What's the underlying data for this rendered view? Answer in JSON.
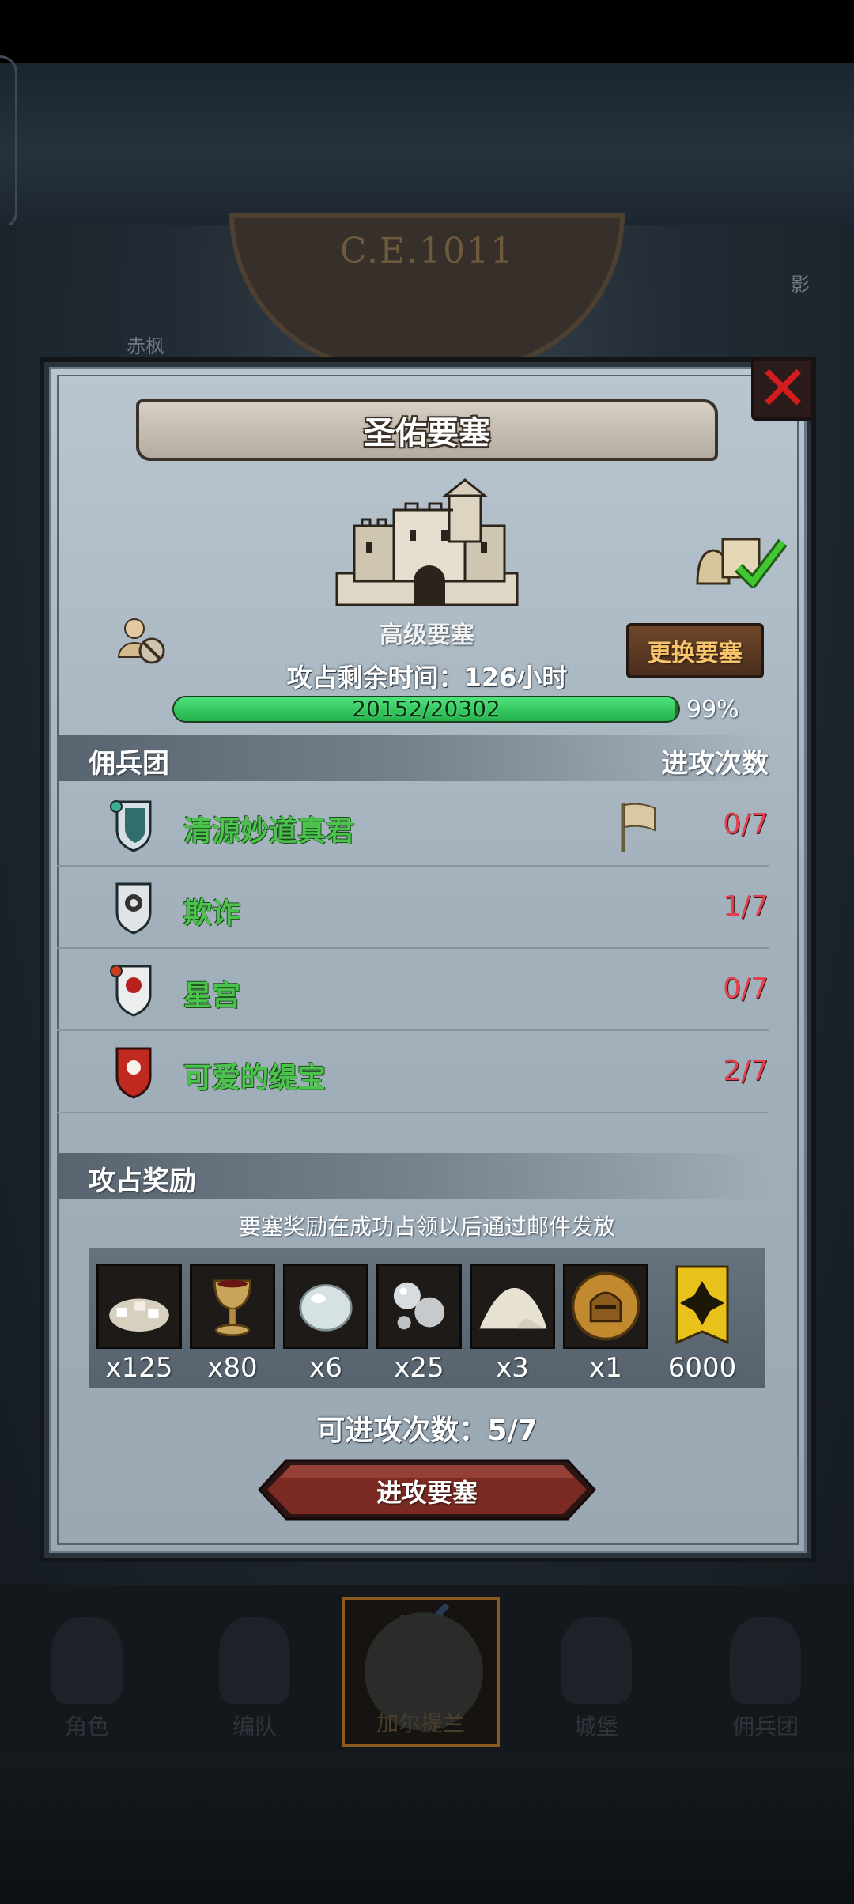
{
  "background": {
    "era": "C.E.1011",
    "map_labels": [
      "赤枫",
      "影"
    ]
  },
  "dialog": {
    "title": "圣佑要塞",
    "fortress_type": "高级要塞",
    "change_button": "更换要塞",
    "time_left": "攻占剩余时间：126小时",
    "progress": {
      "text": "20152/20302",
      "current": 20152,
      "total": 20302,
      "percent_label": "99%"
    },
    "mercenary_section": {
      "title": "佣兵团",
      "count_header": "进攻次数",
      "rows": [
        {
          "name": "清源妙道真君",
          "count": "0/7",
          "shield": "shield-green-icon",
          "flag": true
        },
        {
          "name": "欺诈",
          "count": "1/7",
          "shield": "shield-grey-icon",
          "flag": false
        },
        {
          "name": "星宫",
          "count": "0/7",
          "shield": "shield-red-white-icon",
          "flag": false
        },
        {
          "name": "可爱的缇宝",
          "count": "2/7",
          "shield": "shield-red-icon",
          "flag": false
        }
      ]
    },
    "reward_section": {
      "title": "攻占奖励",
      "note": "要塞奖励在成功占领以后通过邮件发放",
      "items": [
        {
          "icon": "stone-pile-icon",
          "qty": "x125"
        },
        {
          "icon": "golden-chalice-icon",
          "qty": "x80"
        },
        {
          "icon": "crystal-stone-icon",
          "qty": "x6"
        },
        {
          "icon": "silver-orbs-icon",
          "qty": "x25"
        },
        {
          "icon": "salt-pile-icon",
          "qty": "x3"
        },
        {
          "icon": "knight-helmet-medal-icon",
          "qty": "x1"
        },
        {
          "icon": "gold-banner-icon",
          "qty": "6000"
        }
      ]
    },
    "attacks_available": "可进攻次数：5/7",
    "attack_button": "进攻要塞"
  },
  "bottom_nav": [
    {
      "label": "角色",
      "active": false
    },
    {
      "label": "编队",
      "active": false
    },
    {
      "label": "加尔提兰",
      "active": true
    },
    {
      "label": "城堡",
      "active": false
    },
    {
      "label": "佣兵团",
      "active": false
    }
  ],
  "colors": {
    "name_green": "#4cc34d",
    "count_red": "#e2424e",
    "progress_green": "#2fc65a",
    "close_red": "#d31d1d",
    "change_button_text": "#f7c36b"
  }
}
